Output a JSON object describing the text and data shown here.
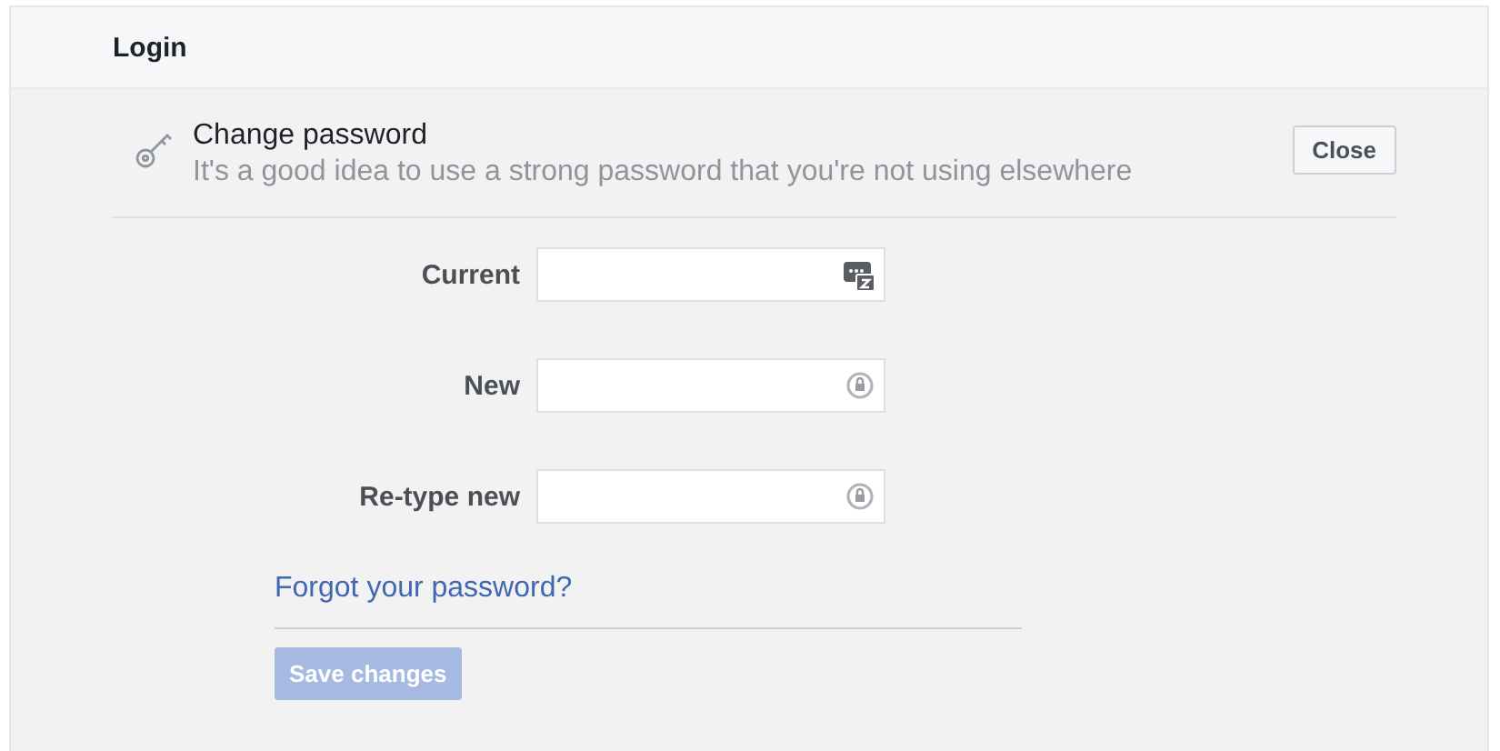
{
  "section": {
    "title": "Login"
  },
  "change_password": {
    "title": "Change password",
    "subtitle": "It's a good idea to use a strong password that you're not using elsewhere",
    "close_button": "Close"
  },
  "fields": [
    {
      "label": "Current",
      "kind": "manager"
    },
    {
      "label": "New",
      "kind": "lock"
    },
    {
      "label": "Re-type new",
      "kind": "lock"
    }
  ],
  "forgot_link": "Forgot your password?",
  "save_button": {
    "label": "Save changes",
    "disabled": true
  }
}
